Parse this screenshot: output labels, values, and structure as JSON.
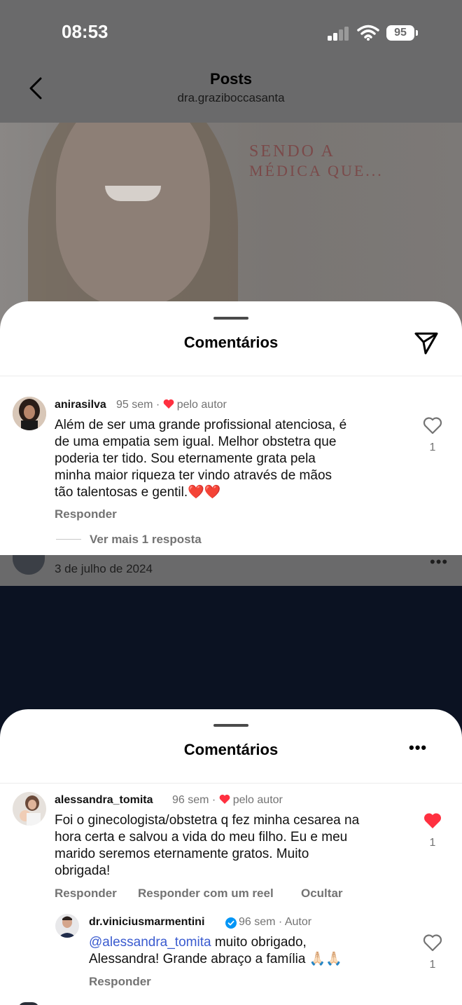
{
  "status_bar": {
    "time": "08:53",
    "battery": "95"
  },
  "nav": {
    "title": "Posts",
    "subtitle": "dra.graziboccasanta"
  },
  "post_image": {
    "line1": "SENDO A",
    "line2": "MÉDICA QUE..."
  },
  "sheet1": {
    "title": "Comentários",
    "comment": {
      "username": "anirasilva",
      "time": "95 sem",
      "separator": "·",
      "author_like": "pelo autor",
      "text_lines": [
        "Além  de ser uma grande profissional atenciosa, é",
        "de uma empatia sem igual. Melhor obstetra que",
        "poderia ter tido. Sou eternamente  grata pela",
        "minha maior riqueza ter vindo através  de mãos",
        "tão  talentosas e gentil.❤️❤️"
      ],
      "reply_label": "Responder",
      "view_more": "Ver mais 1 resposta",
      "likes": "1"
    }
  },
  "strip": {
    "date": "3 de julho de 2024",
    "dots": "•••"
  },
  "sheet2": {
    "title": "Comentários",
    "more": "•••",
    "comment": {
      "username": "alessandra_tomita",
      "time": "96 sem",
      "separator": "·",
      "author_like": "pelo autor",
      "text_lines": [
        "Foi o ginecologista/obstetra q fez minha cesarea na",
        "hora certa e salvou a vida  do meu filho. Eu e meu",
        "marido seremos eternamente gratos. Muito",
        "obrigada!"
      ],
      "actions": [
        "Responder",
        "Responder com um reel",
        "Ocultar"
      ],
      "likes": "1",
      "liked": true
    },
    "reply": {
      "username": "dr.viniciusmarmentini",
      "time": "96 sem",
      "separator": "·",
      "author_tag": "Autor",
      "mention": "@alessandra_tomita",
      "text_after_mention": " muito obrigado,",
      "text_line2": "Alessandra! Grande abraço a família 🙏🏻🙏🏻",
      "reply_label": "Responder",
      "likes": "1"
    }
  },
  "colors": {
    "like_red": "#ff3040",
    "mention_blue": "#3a5bcf",
    "verified_blue": "#0095f6"
  }
}
